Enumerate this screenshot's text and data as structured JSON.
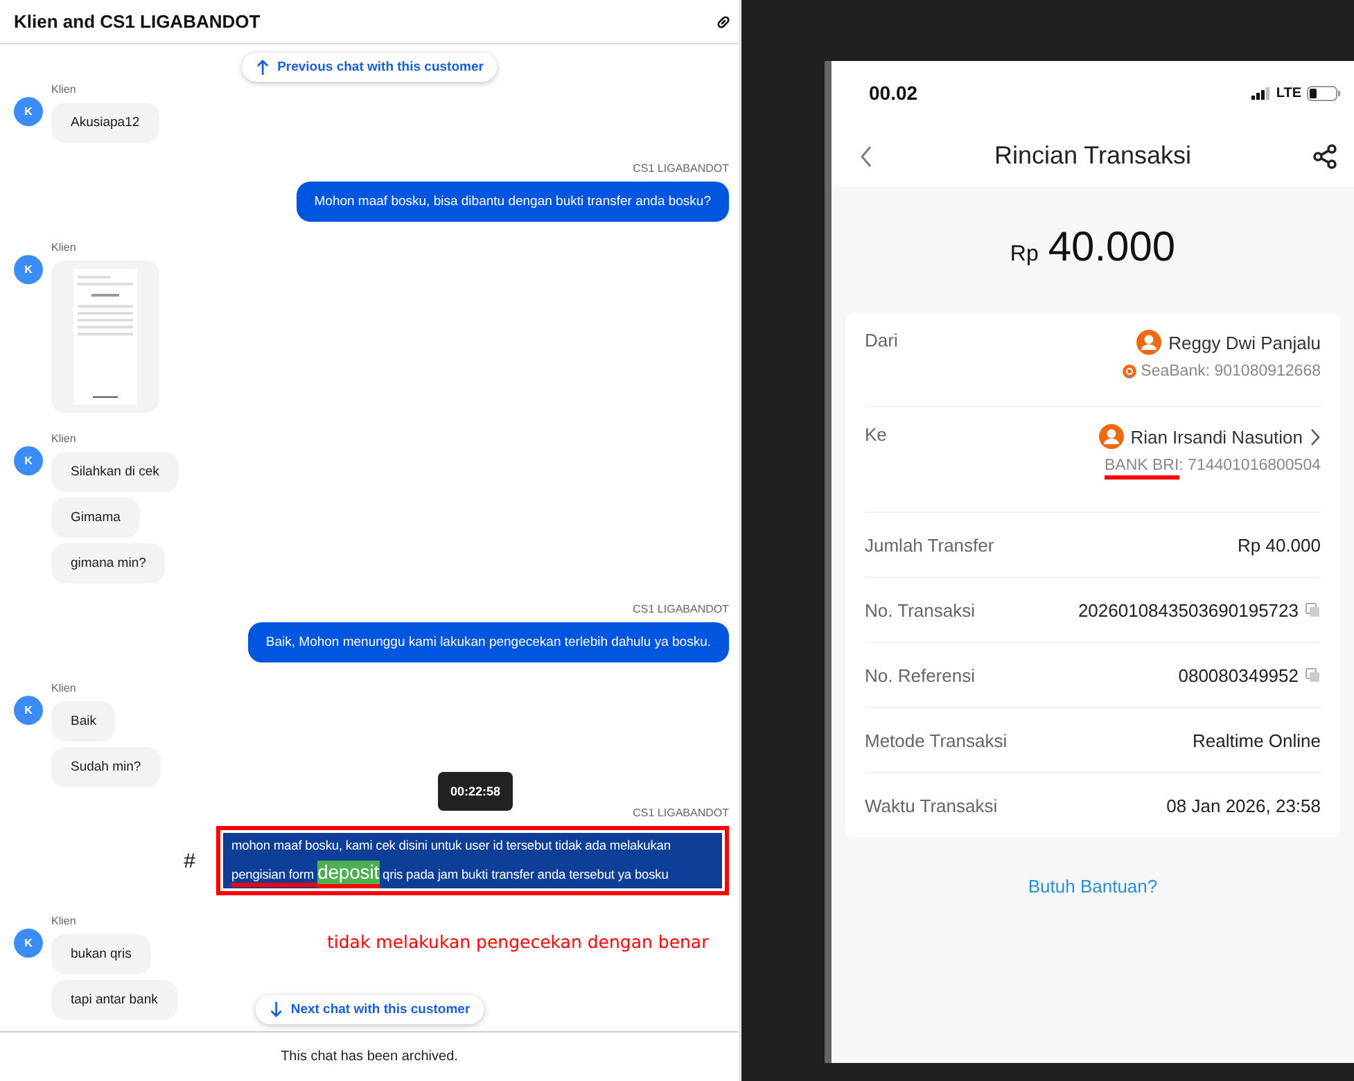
{
  "chat": {
    "title": "Klien and CS1 LIGABANDOT",
    "previous_button": "Previous chat with this customer",
    "messages": [
      {
        "kind": "incoming",
        "sender": "Klien",
        "avatar": "K",
        "bubbles": [
          {
            "kind": "text",
            "parts": [
              {
                "text": "Akusiapa12"
              }
            ]
          }
        ]
      },
      {
        "kind": "outgoing",
        "sender": "CS1 LIGABANDOT",
        "bubbles": [
          {
            "kind": "text",
            "parts": [
              {
                "text": "Mohon maaf bosku, bisa dibantu dengan bukti transfer anda bosku?"
              }
            ]
          }
        ]
      },
      {
        "kind": "incoming",
        "sender": "Klien",
        "avatar": "K",
        "bubbles": [
          {
            "kind": "image"
          }
        ]
      },
      {
        "kind": "incoming",
        "sender": "Klien",
        "avatar": "K",
        "bubbles": [
          {
            "kind": "text",
            "parts": [
              {
                "text": "Silahkan di cek"
              }
            ]
          },
          {
            "kind": "text",
            "parts": [
              {
                "text": "Gimama"
              }
            ]
          },
          {
            "kind": "text",
            "parts": [
              {
                "text": "gimana min?"
              }
            ]
          }
        ]
      },
      {
        "kind": "outgoing",
        "sender": "CS1 LIGABANDOT",
        "bubbles": [
          {
            "kind": "text",
            "parts": [
              {
                "text": "Baik, Mohon menunggu kami lakukan pengecekan terlebih dahulu ya bosku."
              }
            ]
          }
        ]
      },
      {
        "kind": "incoming",
        "sender": "Klien",
        "avatar": "K",
        "bubbles": [
          {
            "kind": "text",
            "parts": [
              {
                "text": "Baik"
              }
            ]
          },
          {
            "kind": "text",
            "parts": [
              {
                "text": "Sudah min?"
              }
            ]
          }
        ]
      },
      {
        "kind": "outgoing",
        "sender": "CS1 LIGABANDOT",
        "marker": "#",
        "tooltip": "00:22:58",
        "annotated": true,
        "bubbles": [
          {
            "kind": "text",
            "parts": [
              {
                "text": "mohon maaf bosku, kami cek disini untuk user id tersebut tidak ada melakukan "
              },
              {
                "text": "pengisian form ",
                "marked": true
              },
              {
                "text": "deposit",
                "marked": true,
                "highlight": true
              },
              {
                "text": " qris pada jam bukti transfer anda tersebut ya bosku"
              }
            ]
          }
        ]
      },
      {
        "kind": "incoming",
        "sender": "Klien",
        "avatar": "K",
        "note": "tidak melakukan pengecekan dengan benar",
        "bubbles": [
          {
            "kind": "text",
            "parts": [
              {
                "text": "bukan qris"
              }
            ]
          },
          {
            "kind": "text",
            "parts": [
              {
                "text": "tapi antar bank"
              }
            ]
          }
        ]
      }
    ],
    "next_button": "Next chat with this customer",
    "footer": "This chat has been archived."
  },
  "phone": {
    "status_time": "00.02",
    "network": "LTE",
    "title": "Rincian Transaksi",
    "currency": "Rp",
    "amount": "40.000",
    "details": [
      {
        "kind": "party",
        "label": "Dari",
        "name": "Reggy Dwi Panjalu",
        "bank_icon": true,
        "chevron": false,
        "account": [
          {
            "text": "SeaBank: 901080912668"
          }
        ]
      },
      {
        "kind": "party",
        "label": "Ke",
        "name": "Rian Irsandi Nasution",
        "bank_icon": false,
        "chevron": true,
        "account": [
          {
            "text": "BANK BRI",
            "marked": true
          },
          {
            "text": ": 714401016800504"
          }
        ]
      },
      {
        "kind": "text",
        "label": "Jumlah Transfer",
        "value": "Rp 40.000"
      },
      {
        "kind": "copy",
        "label": "No. Transaksi",
        "value": "2026010843503690195723"
      },
      {
        "kind": "copy",
        "label": "No. Referensi",
        "value": "080080349952"
      },
      {
        "kind": "text",
        "label": "Metode Transaksi",
        "value": "Realtime Online"
      },
      {
        "kind": "text",
        "label": "Waktu Transaksi",
        "value": "08 Jan 2026, 23:58"
      }
    ],
    "help_link": "Butuh Bantuan?"
  }
}
